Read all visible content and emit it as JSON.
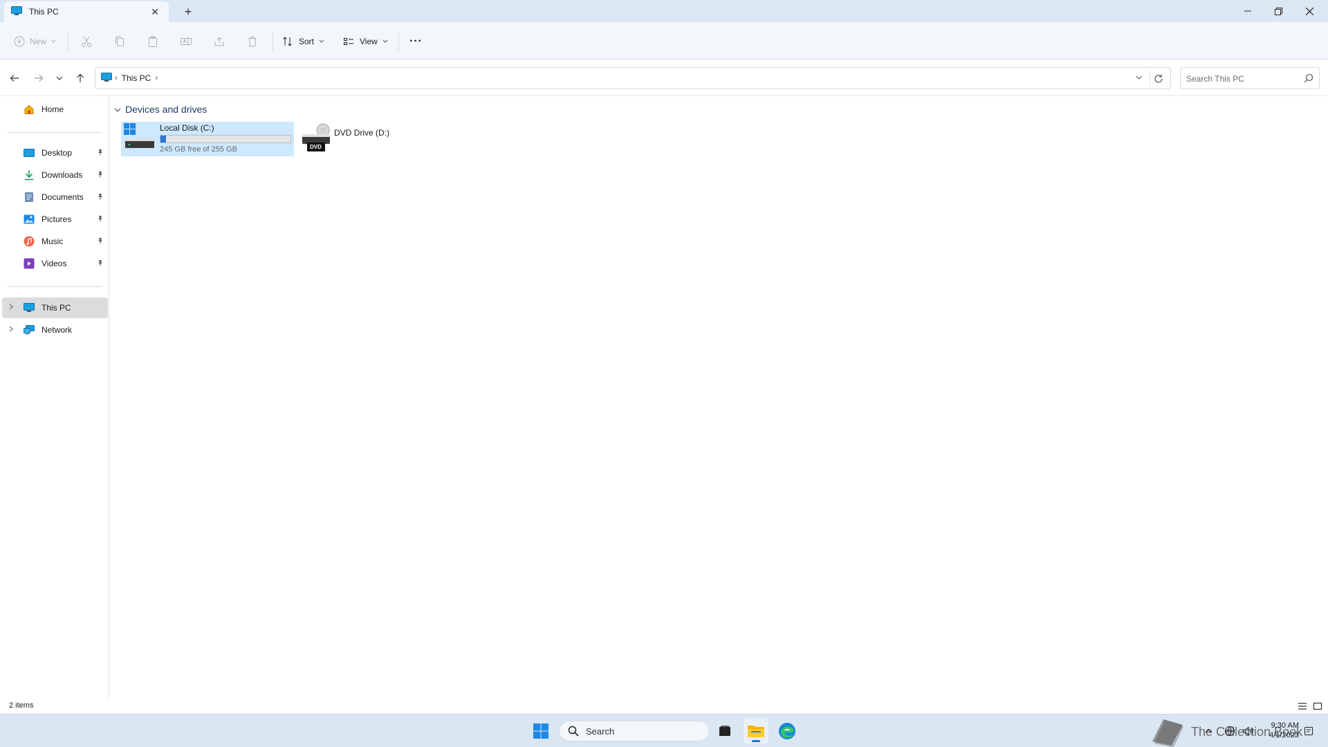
{
  "window": {
    "tab_title": "This PC",
    "tab_close": "✕",
    "new_tab": "+",
    "minimize": "—",
    "maximize": "❐",
    "close": "✕"
  },
  "toolbar": {
    "new_label": "New",
    "sort_label": "Sort",
    "view_label": "View",
    "more": "···"
  },
  "address": {
    "path_crumb": "This PC",
    "chevron": "›",
    "search_placeholder": "Search This PC"
  },
  "sidebar": {
    "home": "Home",
    "pinned": [
      {
        "label": "Desktop"
      },
      {
        "label": "Downloads"
      },
      {
        "label": "Documents"
      },
      {
        "label": "Pictures"
      },
      {
        "label": "Music"
      },
      {
        "label": "Videos"
      }
    ],
    "this_pc": "This PC",
    "network": "Network"
  },
  "content": {
    "group_title": "Devices and drives",
    "drives": [
      {
        "name": "Local Disk (C:)",
        "free_text": "245 GB free of 255 GB",
        "used_fraction": 0.04
      },
      {
        "name": "DVD Drive (D:)",
        "badge": "DVD"
      }
    ]
  },
  "status": {
    "items_count": "2 items"
  },
  "taskbar": {
    "search_label": "Search",
    "time": "9:30 AM",
    "date": "4/1/2023",
    "watermark_text": "The Collection Book"
  },
  "colors": {
    "accent": "#2a7ad5",
    "selection": "#cde8ff",
    "taskbar": "#dae6f2"
  }
}
